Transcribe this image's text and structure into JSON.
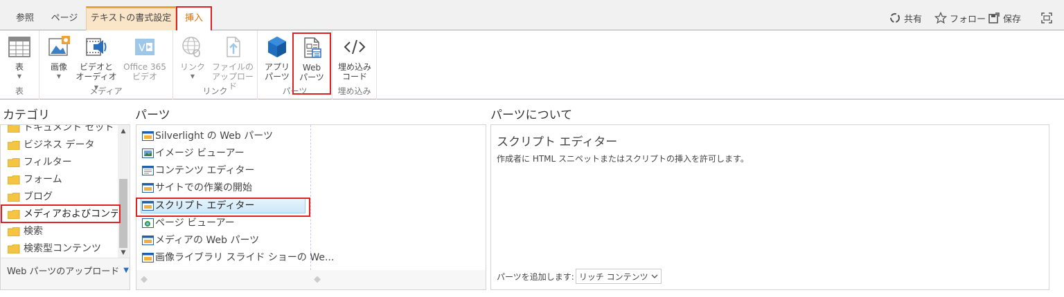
{
  "tabs": [
    {
      "label": "参照"
    },
    {
      "label": "ページ"
    },
    {
      "label": "テキストの書式設定"
    },
    {
      "label": "挿入"
    }
  ],
  "header_actions": {
    "share": "共有",
    "follow": "フォロー",
    "save": "保存"
  },
  "ribbon": {
    "groups": [
      {
        "label": "表",
        "buttons": [
          {
            "line1": "表",
            "line2": ""
          }
        ]
      },
      {
        "label": "メディア",
        "buttons": [
          {
            "line1": "画像",
            "line2": ""
          },
          {
            "line1": "ビデオと",
            "line2": "オーディオ"
          },
          {
            "line1": "Office 365",
            "line2": "ビデオ"
          }
        ]
      },
      {
        "label": "リンク",
        "buttons": [
          {
            "line1": "リンク",
            "line2": ""
          },
          {
            "line1": "ファイルの",
            "line2": "アップロード"
          }
        ]
      },
      {
        "label": "パーツ",
        "buttons": [
          {
            "line1": "アプリ",
            "line2": "パーツ"
          },
          {
            "line1": "Web",
            "line2": "パーツ"
          }
        ]
      },
      {
        "label": "埋め込み",
        "buttons": [
          {
            "line1": "埋め込み",
            "line2": "コード"
          }
        ]
      }
    ]
  },
  "categories": {
    "title": "カテゴリ",
    "items": [
      {
        "label": "ドキュメント セット"
      },
      {
        "label": "ビジネス データ"
      },
      {
        "label": "フィルター"
      },
      {
        "label": "フォーム"
      },
      {
        "label": "ブログ"
      },
      {
        "label": "メディアおよびコンテンツ"
      },
      {
        "label": "検索"
      },
      {
        "label": "検索型コンテンツ"
      }
    ],
    "upload_label": "Web パーツのアップロード"
  },
  "parts": {
    "title": "パーツ",
    "items": [
      {
        "label": "Silverlight の Web パーツ"
      },
      {
        "label": "イメージ ビューアー"
      },
      {
        "label": "コンテンツ エディター"
      },
      {
        "label": "サイトでの作業の開始"
      },
      {
        "label": "スクリプト エディター"
      },
      {
        "label": "ページ ビューアー"
      },
      {
        "label": "メディアの Web パーツ"
      },
      {
        "label": "画像ライブラリ スライド ショーの We..."
      }
    ]
  },
  "about": {
    "title": "パーツについて",
    "part_name": "スクリプト エディター",
    "description": "作成者に HTML スニペットまたはスクリプトの挿入を許可します。",
    "add_label": "パーツを追加します:",
    "zone_value": "リッチ コンテンツ"
  },
  "colors": {
    "accent_orange": "#f0a030",
    "highlight_red": "#e02020",
    "folder_yellow": "#f4c542",
    "selected_blue": "#cce8f8"
  }
}
